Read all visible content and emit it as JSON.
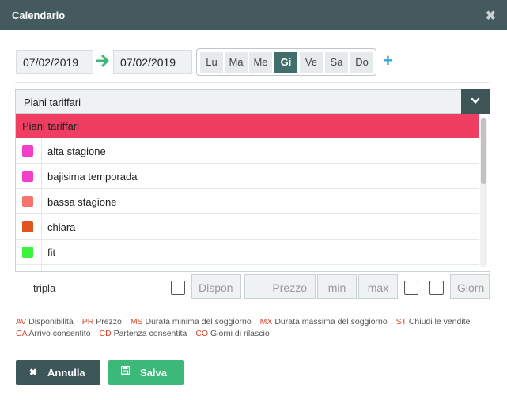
{
  "window": {
    "title": "Calendario",
    "close_icon": "close-icon"
  },
  "dates": {
    "from": "07/02/2019",
    "to": "07/02/2019"
  },
  "days": [
    {
      "label": "Lu",
      "active": false
    },
    {
      "label": "Ma",
      "active": false
    },
    {
      "label": "Me",
      "active": false
    },
    {
      "label": "Gi",
      "active": true
    },
    {
      "label": "Ve",
      "active": false
    },
    {
      "label": "Sa",
      "active": false
    },
    {
      "label": "Do",
      "active": false
    }
  ],
  "add_label": "+",
  "dropdown": {
    "selected": "Piani tariffari",
    "header": "Piani tariffari",
    "options": [
      {
        "label": "alta stagione",
        "color": "#f23fc9"
      },
      {
        "label": "bajisima temporada",
        "color": "#f23fc9"
      },
      {
        "label": "bassa stagione",
        "color": "#f7746c"
      },
      {
        "label": "chiara",
        "color": "#e05420"
      },
      {
        "label": "fit",
        "color": "#3bf23f"
      }
    ]
  },
  "room_row": {
    "label": "tripla",
    "fields": [
      "Dispon",
      "Prezzo",
      "min",
      "max",
      "Giorn"
    ]
  },
  "legend": [
    [
      {
        "code": "AV",
        "text": "Disponibilità"
      },
      {
        "code": "PR",
        "text": "Prezzo"
      },
      {
        "code": "MS",
        "text": "Durata minima del soggiorno"
      },
      {
        "code": "MX",
        "text": "Durata massima del soggiorno"
      },
      {
        "code": "ST",
        "text": "Chiudi le vendite"
      }
    ],
    [
      {
        "code": "CA",
        "text": "Arrivo consentito"
      },
      {
        "code": "CD",
        "text": "Partenza consentita"
      },
      {
        "code": "CO",
        "text": "Giorni di rilascio"
      }
    ]
  ],
  "buttons": {
    "cancel": "Annulla",
    "save": "Salva"
  },
  "colors": {
    "titlebar": "#455a5e",
    "header_row": "#ee3f62",
    "active_day": "#3f6e6c",
    "save": "#3cb878",
    "cancel": "#3d5659",
    "plus": "#3ea4d8",
    "arrow": "#3cb878"
  }
}
